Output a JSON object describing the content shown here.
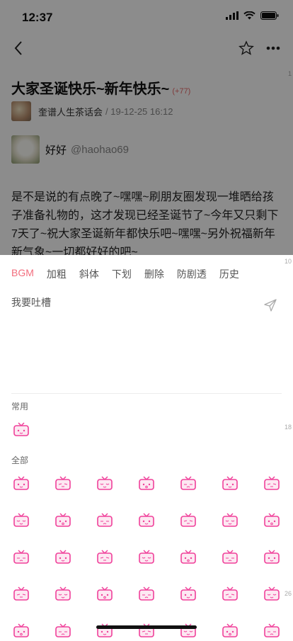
{
  "status": {
    "time": "12:37"
  },
  "post": {
    "title": "大家圣诞快乐~新年快乐~",
    "count": "(+77)",
    "board": "奎谱人生茶话会",
    "date": "/ 19-12-25 16:12",
    "username": "好好",
    "handle": "@haohao69",
    "body": "是不是说的有点晚了~嘿嘿~刷朋友圈发现一堆晒给孩子准备礼物的，这才发现已经圣诞节了~今年又只剩下7天了~祝大家圣诞新年都快乐吧~嘿嘿~另外祝福新年新气象~一切都好好的吧~"
  },
  "floors": [
    "1",
    "10",
    "18",
    "26"
  ],
  "editor": {
    "tabs": [
      "BGM",
      "加粗",
      "斜体",
      "下划",
      "删除",
      "防剧透",
      "历史"
    ],
    "active_tab": "BGM",
    "placeholder": "我要吐槽",
    "common_label": "常用",
    "all_label": "全部"
  },
  "colors": {
    "accent": "#f26d7d",
    "emoji_pink": "#f0409a",
    "dim": "rgba(0,0,0,0.45)"
  },
  "icons": [
    "back-icon",
    "star-icon",
    "more-icon",
    "send-icon",
    "tv-emoji-icon"
  ]
}
